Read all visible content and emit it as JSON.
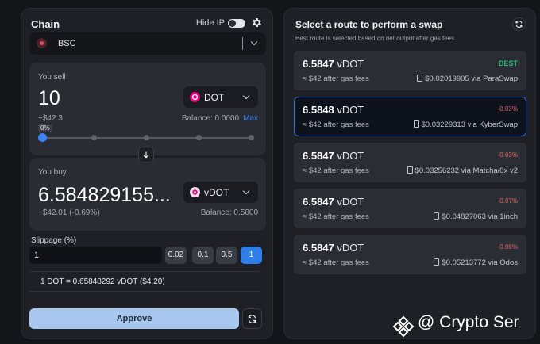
{
  "left": {
    "title": "Chain",
    "hide_ip_label": "Hide IP",
    "chain": {
      "name": "BSC"
    },
    "sell": {
      "label": "You sell",
      "amount": "10",
      "token": "DOT",
      "usd": "~$42.3",
      "balance": "Balance: 0.0000",
      "max": "Max",
      "percent_tip": "0%",
      "slider_fraction": 0
    },
    "buy": {
      "label": "You buy",
      "amount": "6.584829155...",
      "token": "vDOT",
      "usd": "~$42.01 (-0.69%)",
      "balance": "Balance: 0.5000"
    },
    "slippage": {
      "label": "Slippage (%)",
      "value": "1",
      "options": [
        "0.02",
        "0.1",
        "0.5",
        "1"
      ],
      "selected": "1"
    },
    "rate": "1 DOT = 0.65848292 vDOT ($4.20)",
    "approve_label": "Approve"
  },
  "right": {
    "title": "Select a route to perform a swap",
    "subtitle": "Best route is selected based on net output after gas fees.",
    "routes": [
      {
        "amount": "6.5847",
        "unit": "vDOT",
        "tag": "BEST",
        "fees": "≈ $42 after gas fees",
        "via": "$0.02019905 via ParaSwap"
      },
      {
        "amount": "6.5848",
        "unit": "vDOT",
        "tag": "-0.03%",
        "fees": "≈ $42 after gas fees",
        "via": "$0.03229313 via KyberSwap"
      },
      {
        "amount": "6.5847",
        "unit": "vDOT",
        "tag": "-0.03%",
        "fees": "≈ $42 after gas fees",
        "via": "$0.03256232 via Matcha/0x v2"
      },
      {
        "amount": "6.5847",
        "unit": "vDOT",
        "tag": "-0.07%",
        "fees": "≈ $42 after gas fees",
        "via": "$0.04827063 via 1inch"
      },
      {
        "amount": "6.5847",
        "unit": "vDOT",
        "tag": "-0.08%",
        "fees": "≈ $42 after gas fees",
        "via": "$0.05213772 via Odos"
      }
    ],
    "selected_route": 1
  },
  "watermark": "@ Crypto Ser",
  "colors": {
    "accent": "#3b82f6",
    "best": "#31b57c",
    "negative": "#e06a6a",
    "dot_token": "#e6007a",
    "approve": "#a7c7ee"
  }
}
